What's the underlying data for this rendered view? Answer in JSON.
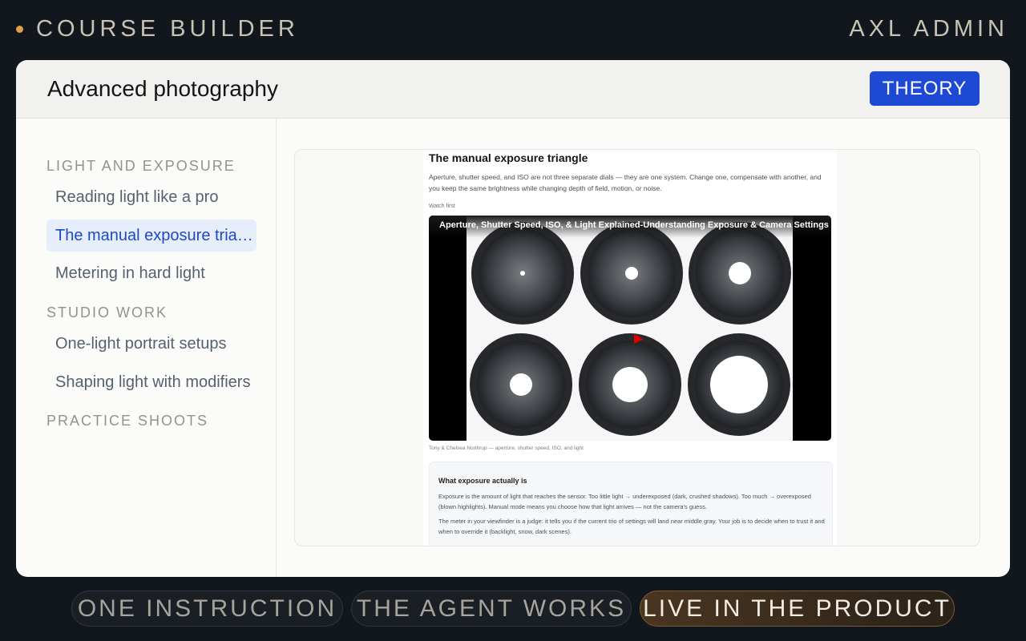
{
  "top_bar": {
    "brand": "COURSE BUILDER",
    "admin": "AXL ADMIN",
    "accent": "#e0a04a"
  },
  "course": {
    "title": "Advanced photography",
    "mode_label": "THEORY"
  },
  "sidebar": {
    "sections": [
      {
        "title": "LIGHT AND EXPOSURE",
        "items": [
          {
            "label": "Reading light like a pro",
            "active": false
          },
          {
            "label": "The manual exposure triangle",
            "active": true
          },
          {
            "label": "Metering in hard light",
            "active": false
          }
        ]
      },
      {
        "title": "STUDIO WORK",
        "items": [
          {
            "label": "One-light portrait setups",
            "active": false
          },
          {
            "label": "Shaping light with modifiers",
            "active": false
          }
        ]
      },
      {
        "title": "PRACTICE SHOOTS",
        "items": []
      }
    ]
  },
  "lesson": {
    "title": "The manual exposure triangle",
    "intro": "Aperture, shutter speed, and ISO are not three separate dials — they are one system. Change one, compensate with another, and you keep the same brightness while changing depth of field, motion, or noise.",
    "watch_label": "Watch first",
    "video_title": "Aperture, Shutter Speed, ISO, & Light Explained-Understanding Exposure & Camera Settings",
    "video_caption": "Tony & Chelsea Northrup — aperture, shutter speed, ISO, and light",
    "info_title": "What exposure actually is",
    "info_p1": "Exposure is the amount of light that reaches the sensor. Too little light → underexposed (dark, crushed shadows). Too much → overexposed (blown highlights). Manual mode means you choose how that light arrives — not the camera's guess.",
    "info_p2": "The meter in your viewfinder is a judge: it tells you if the current trio of settings will land near middle gray. Your job is to decide when to trust it and when to override it (backlight, snow, dark scenes)."
  },
  "steps": [
    "ONE INSTRUCTION",
    "THE AGENT WORKS",
    "LIVE IN THE PRODUCT"
  ],
  "active_step_index": 2,
  "colors": {
    "primary": "#1d49d4",
    "active_nav_bg": "#e7eefb",
    "active_nav_text": "#1d49c4"
  }
}
